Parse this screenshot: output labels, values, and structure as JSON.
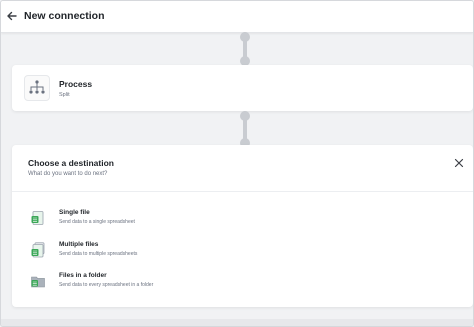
{
  "header": {
    "title": "New connection"
  },
  "process": {
    "title": "Process",
    "subtitle": "Split"
  },
  "destination": {
    "title": "Choose a destination",
    "subtitle": "What do you want to do next?",
    "options": [
      {
        "label": "Single file",
        "description": "Send data to a single spreadsheet",
        "icon": "single-file-icon"
      },
      {
        "label": "Multiple files",
        "description": "Send data to multiple spreadsheets",
        "icon": "multiple-files-icon"
      },
      {
        "label": "Files in a folder",
        "description": "Send data to every spreadsheet in a folder",
        "icon": "folder-files-icon"
      }
    ]
  },
  "colors": {
    "accent_green": "#3aa757",
    "connector": "#c9ccd1",
    "background": "#f1f2f4"
  }
}
